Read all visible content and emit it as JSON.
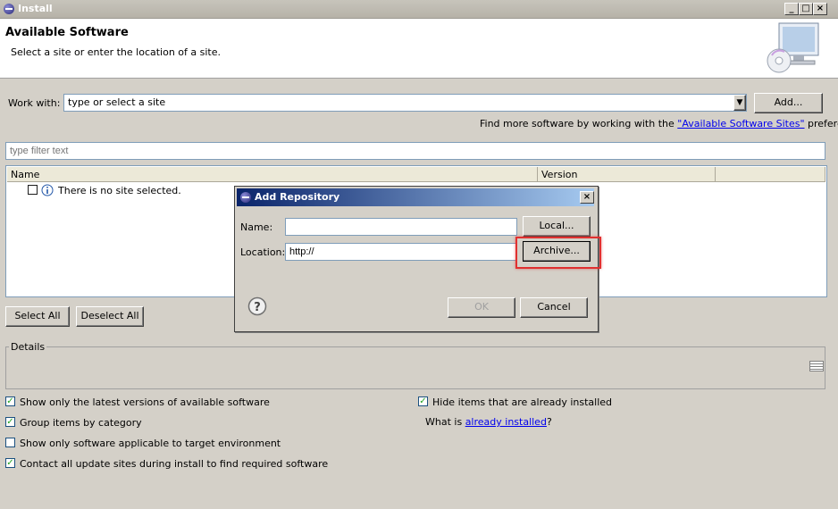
{
  "window": {
    "title": "Install"
  },
  "header": {
    "title": "Available Software",
    "subtitle": "Select a site or enter the location of a site."
  },
  "work_with": {
    "label": "Work with:",
    "value": "type or select a site",
    "add_label": "Add..."
  },
  "find_more": {
    "prefix": "Find more software by working with the ",
    "link": "\"Available Software Sites\"",
    "suffix": " preferences."
  },
  "filter": {
    "placeholder": "type filter text"
  },
  "table": {
    "columns": [
      "Name",
      "Version",
      ""
    ],
    "rows": [
      {
        "text": "There is no site selected."
      }
    ]
  },
  "buttons": {
    "select_all": "Select All",
    "deselect_all": "Deselect All"
  },
  "details": {
    "label": "Details"
  },
  "options": {
    "latest_versions": {
      "label": "Show only the latest versions of available software",
      "checked": true
    },
    "group_by_category": {
      "label": "Group items by category",
      "checked": true
    },
    "applicable_target": {
      "label": "Show only software applicable to target environment",
      "checked": false
    },
    "contact_sites": {
      "label": "Contact all update sites during install to find required software",
      "checked": true
    },
    "hide_installed": {
      "label": "Hide items that are already installed",
      "checked": true
    },
    "what_is": {
      "prefix": "What is ",
      "link": "already installed",
      "suffix": "?"
    }
  },
  "dialog": {
    "title": "Add Repository",
    "name_label": "Name:",
    "name_value": "",
    "location_label": "Location:",
    "location_value": "http://",
    "local_label": "Local...",
    "archive_label": "Archive...",
    "ok_label": "OK",
    "cancel_label": "Cancel"
  },
  "colors": {
    "highlight": "#e03030",
    "link": "#0000ee",
    "dialog_title": "#0a246a"
  }
}
